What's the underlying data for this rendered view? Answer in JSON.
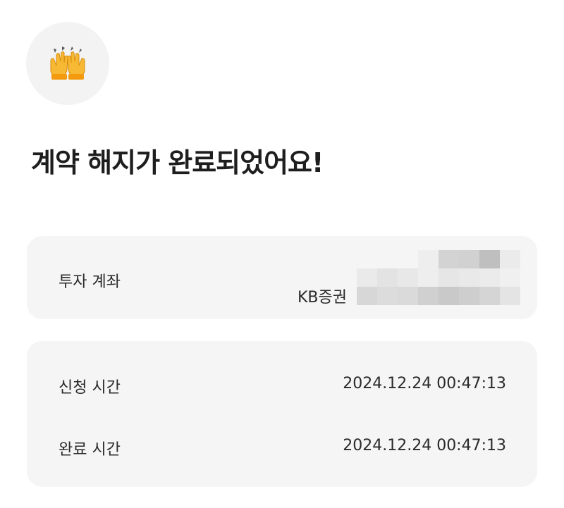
{
  "emoji": {
    "icon": "raising-hands-icon"
  },
  "headline": "계약 해지가 완료되었어요!",
  "account_card": {
    "label": "투자 계좌",
    "broker": "KB증권"
  },
  "times_card": {
    "request_label": "신청 시간",
    "request_value": "2024.12.24 00:47:13",
    "complete_label": "완료 시간",
    "complete_value": "2024.12.24 00:47:13"
  }
}
